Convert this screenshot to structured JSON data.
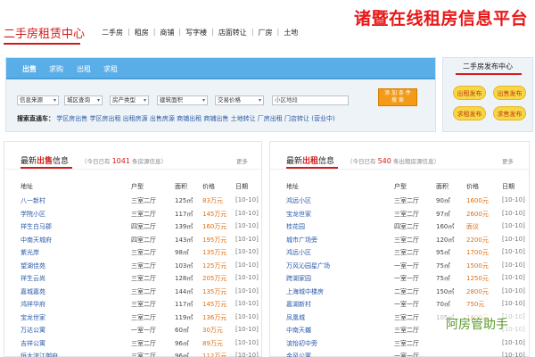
{
  "header": {
    "logo": "二手房租赁中心",
    "nav": [
      "二手房",
      "租房",
      "商铺",
      "写字楼",
      "店面转让",
      "厂房",
      "土地"
    ],
    "headline": "诸暨在线租房信息平台"
  },
  "search": {
    "tabs": [
      "出售",
      "求购",
      "出租",
      "求租"
    ],
    "filters": [
      "信息来源",
      "城区查询",
      "房产类型",
      "建筑面积",
      "交易价格"
    ],
    "district_placeholder": "小区地段",
    "search_button": "添 加 条 件\n搜  索",
    "quick_label": "搜索直通车",
    "quick_links": "学区房出售 学区房出租 出租房源 出售房源 商铺出租 商铺出售 土地转让 厂房出租 门店转让 (营业中)"
  },
  "publish": {
    "title": "二手房发布中心",
    "buttons": [
      "出租发布",
      "出售发布",
      "求租发布",
      "求售发布"
    ]
  },
  "sale": {
    "title_prefix": "最新",
    "title_highlight": "出售",
    "title_suffix": "信息",
    "subtitle_prefix": "（今日已有",
    "count": "1041",
    "subtitle_suffix": "条房源信息）",
    "more": "更多",
    "columns": [
      "地址",
      "户型",
      "面积",
      "价格",
      "日期"
    ],
    "rows": [
      [
        "八一新村",
        "三室二厅",
        "125㎡",
        "83万元",
        "[10-10]"
      ],
      [
        "学院小区",
        "三室二厅",
        "117㎡",
        "145万元",
        "[10-10]"
      ],
      [
        "祥生白马郡",
        "四室二厅",
        "139㎡",
        "160万元",
        "[10-10]"
      ],
      [
        "中南天城府",
        "四室二厅",
        "143㎡",
        "195万元",
        "[10-10]"
      ],
      [
        "紫光岸",
        "三室二厅",
        "98㎡",
        "135万元",
        "[10-10]"
      ],
      [
        "望湖佳苑",
        "三室二厅",
        "103㎡",
        "125万元",
        "[10-10]"
      ],
      [
        "祥生云尚",
        "三室二厅",
        "128㎡",
        "205万元",
        "[10-10]"
      ],
      [
        "嘉城嘉苑",
        "三室二厅",
        "144㎡",
        "135万元",
        "[10-10]"
      ],
      [
        "鸿祥华府",
        "三室二厅",
        "117㎡",
        "145万元",
        "[10-10]"
      ],
      [
        "宝龙世家",
        "三室二厅",
        "119㎡",
        "136万元",
        "[10-10]"
      ],
      [
        "万达公寓",
        "一室一厅",
        "60㎡",
        "30万元",
        "[10-10]"
      ],
      [
        "吉祥公寓",
        "三室二厅",
        "96㎡",
        "89万元",
        "[10-10]"
      ],
      [
        "恒大滨江御府",
        "三室二厅",
        "96㎡",
        "112万元",
        "[10-10]"
      ]
    ]
  },
  "rent": {
    "title_prefix": "最新",
    "title_highlight": "出租",
    "title_suffix": "信息",
    "subtitle_prefix": "（今日已有",
    "count": "540",
    "subtitle_suffix": "条出租房源信息）",
    "more": "更多",
    "columns": [
      "地址",
      "户型",
      "面积",
      "价格",
      "日期"
    ],
    "rows": [
      [
        "鸿远小区",
        "三室二厅",
        "90㎡",
        "1600元",
        "[10-10]"
      ],
      [
        "宝龙世家",
        "三室二厅",
        "97㎡",
        "2600元",
        "[10-10]"
      ],
      [
        "桂花园",
        "四室二厅",
        "160㎡",
        "面议",
        "[10-10]"
      ],
      [
        "城市广场旁",
        "三室二厅",
        "120㎡",
        "2200元",
        "[10-10]"
      ],
      [
        "鸿远小区",
        "三室二厅",
        "95㎡",
        "1700元",
        "[10-10]"
      ],
      [
        "万风沁园星广场",
        "一室一厅",
        "75㎡",
        "1500元",
        "[10-10]"
      ],
      [
        "跨湖家园",
        "一室一厅",
        "75㎡",
        "1250元",
        "[10-10]"
      ],
      [
        "上海城中楼房",
        "二室二厅",
        "150㎡",
        "2800元",
        "[10-10]"
      ],
      [
        "嘉湖新村",
        "一室一厅",
        "70㎡",
        "750元",
        "[10-10]"
      ],
      [
        "凤凰城",
        "三室二厅",
        "105㎡",
        "1600元",
        "[10-10]"
      ],
      [
        "中南天樾",
        "三室二厅",
        "",
        "",
        "[10-10]"
      ],
      [
        "滨怡初中旁",
        "三室二厅",
        "",
        "",
        "[10-10]"
      ],
      [
        "金风公寓",
        "一室一厅",
        "",
        "",
        "[10-10]"
      ]
    ]
  },
  "watermark": "阿房管助手"
}
